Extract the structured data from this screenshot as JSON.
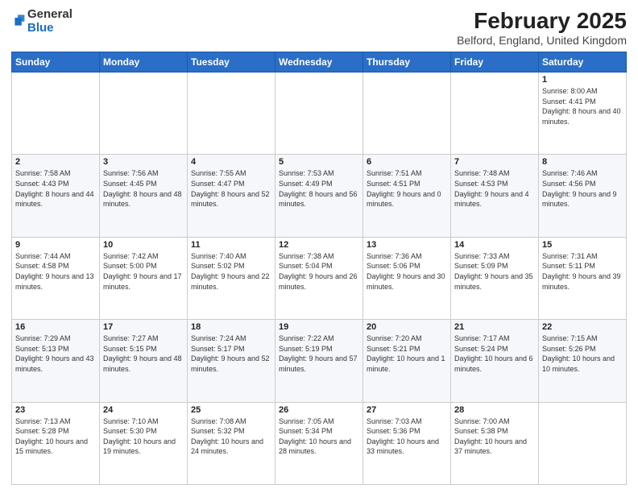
{
  "header": {
    "logo": {
      "general": "General",
      "blue": "Blue"
    },
    "title": "February 2025",
    "subtitle": "Belford, England, United Kingdom"
  },
  "days_of_week": [
    "Sunday",
    "Monday",
    "Tuesday",
    "Wednesday",
    "Thursday",
    "Friday",
    "Saturday"
  ],
  "weeks": [
    [
      {
        "day": "",
        "info": ""
      },
      {
        "day": "",
        "info": ""
      },
      {
        "day": "",
        "info": ""
      },
      {
        "day": "",
        "info": ""
      },
      {
        "day": "",
        "info": ""
      },
      {
        "day": "",
        "info": ""
      },
      {
        "day": "1",
        "info": "Sunrise: 8:00 AM\nSunset: 4:41 PM\nDaylight: 8 hours and 40 minutes."
      }
    ],
    [
      {
        "day": "2",
        "info": "Sunrise: 7:58 AM\nSunset: 4:43 PM\nDaylight: 8 hours and 44 minutes."
      },
      {
        "day": "3",
        "info": "Sunrise: 7:56 AM\nSunset: 4:45 PM\nDaylight: 8 hours and 48 minutes."
      },
      {
        "day": "4",
        "info": "Sunrise: 7:55 AM\nSunset: 4:47 PM\nDaylight: 8 hours and 52 minutes."
      },
      {
        "day": "5",
        "info": "Sunrise: 7:53 AM\nSunset: 4:49 PM\nDaylight: 8 hours and 56 minutes."
      },
      {
        "day": "6",
        "info": "Sunrise: 7:51 AM\nSunset: 4:51 PM\nDaylight: 9 hours and 0 minutes."
      },
      {
        "day": "7",
        "info": "Sunrise: 7:48 AM\nSunset: 4:53 PM\nDaylight: 9 hours and 4 minutes."
      },
      {
        "day": "8",
        "info": "Sunrise: 7:46 AM\nSunset: 4:56 PM\nDaylight: 9 hours and 9 minutes."
      }
    ],
    [
      {
        "day": "9",
        "info": "Sunrise: 7:44 AM\nSunset: 4:58 PM\nDaylight: 9 hours and 13 minutes."
      },
      {
        "day": "10",
        "info": "Sunrise: 7:42 AM\nSunset: 5:00 PM\nDaylight: 9 hours and 17 minutes."
      },
      {
        "day": "11",
        "info": "Sunrise: 7:40 AM\nSunset: 5:02 PM\nDaylight: 9 hours and 22 minutes."
      },
      {
        "day": "12",
        "info": "Sunrise: 7:38 AM\nSunset: 5:04 PM\nDaylight: 9 hours and 26 minutes."
      },
      {
        "day": "13",
        "info": "Sunrise: 7:36 AM\nSunset: 5:06 PM\nDaylight: 9 hours and 30 minutes."
      },
      {
        "day": "14",
        "info": "Sunrise: 7:33 AM\nSunset: 5:09 PM\nDaylight: 9 hours and 35 minutes."
      },
      {
        "day": "15",
        "info": "Sunrise: 7:31 AM\nSunset: 5:11 PM\nDaylight: 9 hours and 39 minutes."
      }
    ],
    [
      {
        "day": "16",
        "info": "Sunrise: 7:29 AM\nSunset: 5:13 PM\nDaylight: 9 hours and 43 minutes."
      },
      {
        "day": "17",
        "info": "Sunrise: 7:27 AM\nSunset: 5:15 PM\nDaylight: 9 hours and 48 minutes."
      },
      {
        "day": "18",
        "info": "Sunrise: 7:24 AM\nSunset: 5:17 PM\nDaylight: 9 hours and 52 minutes."
      },
      {
        "day": "19",
        "info": "Sunrise: 7:22 AM\nSunset: 5:19 PM\nDaylight: 9 hours and 57 minutes."
      },
      {
        "day": "20",
        "info": "Sunrise: 7:20 AM\nSunset: 5:21 PM\nDaylight: 10 hours and 1 minute."
      },
      {
        "day": "21",
        "info": "Sunrise: 7:17 AM\nSunset: 5:24 PM\nDaylight: 10 hours and 6 minutes."
      },
      {
        "day": "22",
        "info": "Sunrise: 7:15 AM\nSunset: 5:26 PM\nDaylight: 10 hours and 10 minutes."
      }
    ],
    [
      {
        "day": "23",
        "info": "Sunrise: 7:13 AM\nSunset: 5:28 PM\nDaylight: 10 hours and 15 minutes."
      },
      {
        "day": "24",
        "info": "Sunrise: 7:10 AM\nSunset: 5:30 PM\nDaylight: 10 hours and 19 minutes."
      },
      {
        "day": "25",
        "info": "Sunrise: 7:08 AM\nSunset: 5:32 PM\nDaylight: 10 hours and 24 minutes."
      },
      {
        "day": "26",
        "info": "Sunrise: 7:05 AM\nSunset: 5:34 PM\nDaylight: 10 hours and 28 minutes."
      },
      {
        "day": "27",
        "info": "Sunrise: 7:03 AM\nSunset: 5:36 PM\nDaylight: 10 hours and 33 minutes."
      },
      {
        "day": "28",
        "info": "Sunrise: 7:00 AM\nSunset: 5:38 PM\nDaylight: 10 hours and 37 minutes."
      },
      {
        "day": "",
        "info": ""
      }
    ]
  ]
}
